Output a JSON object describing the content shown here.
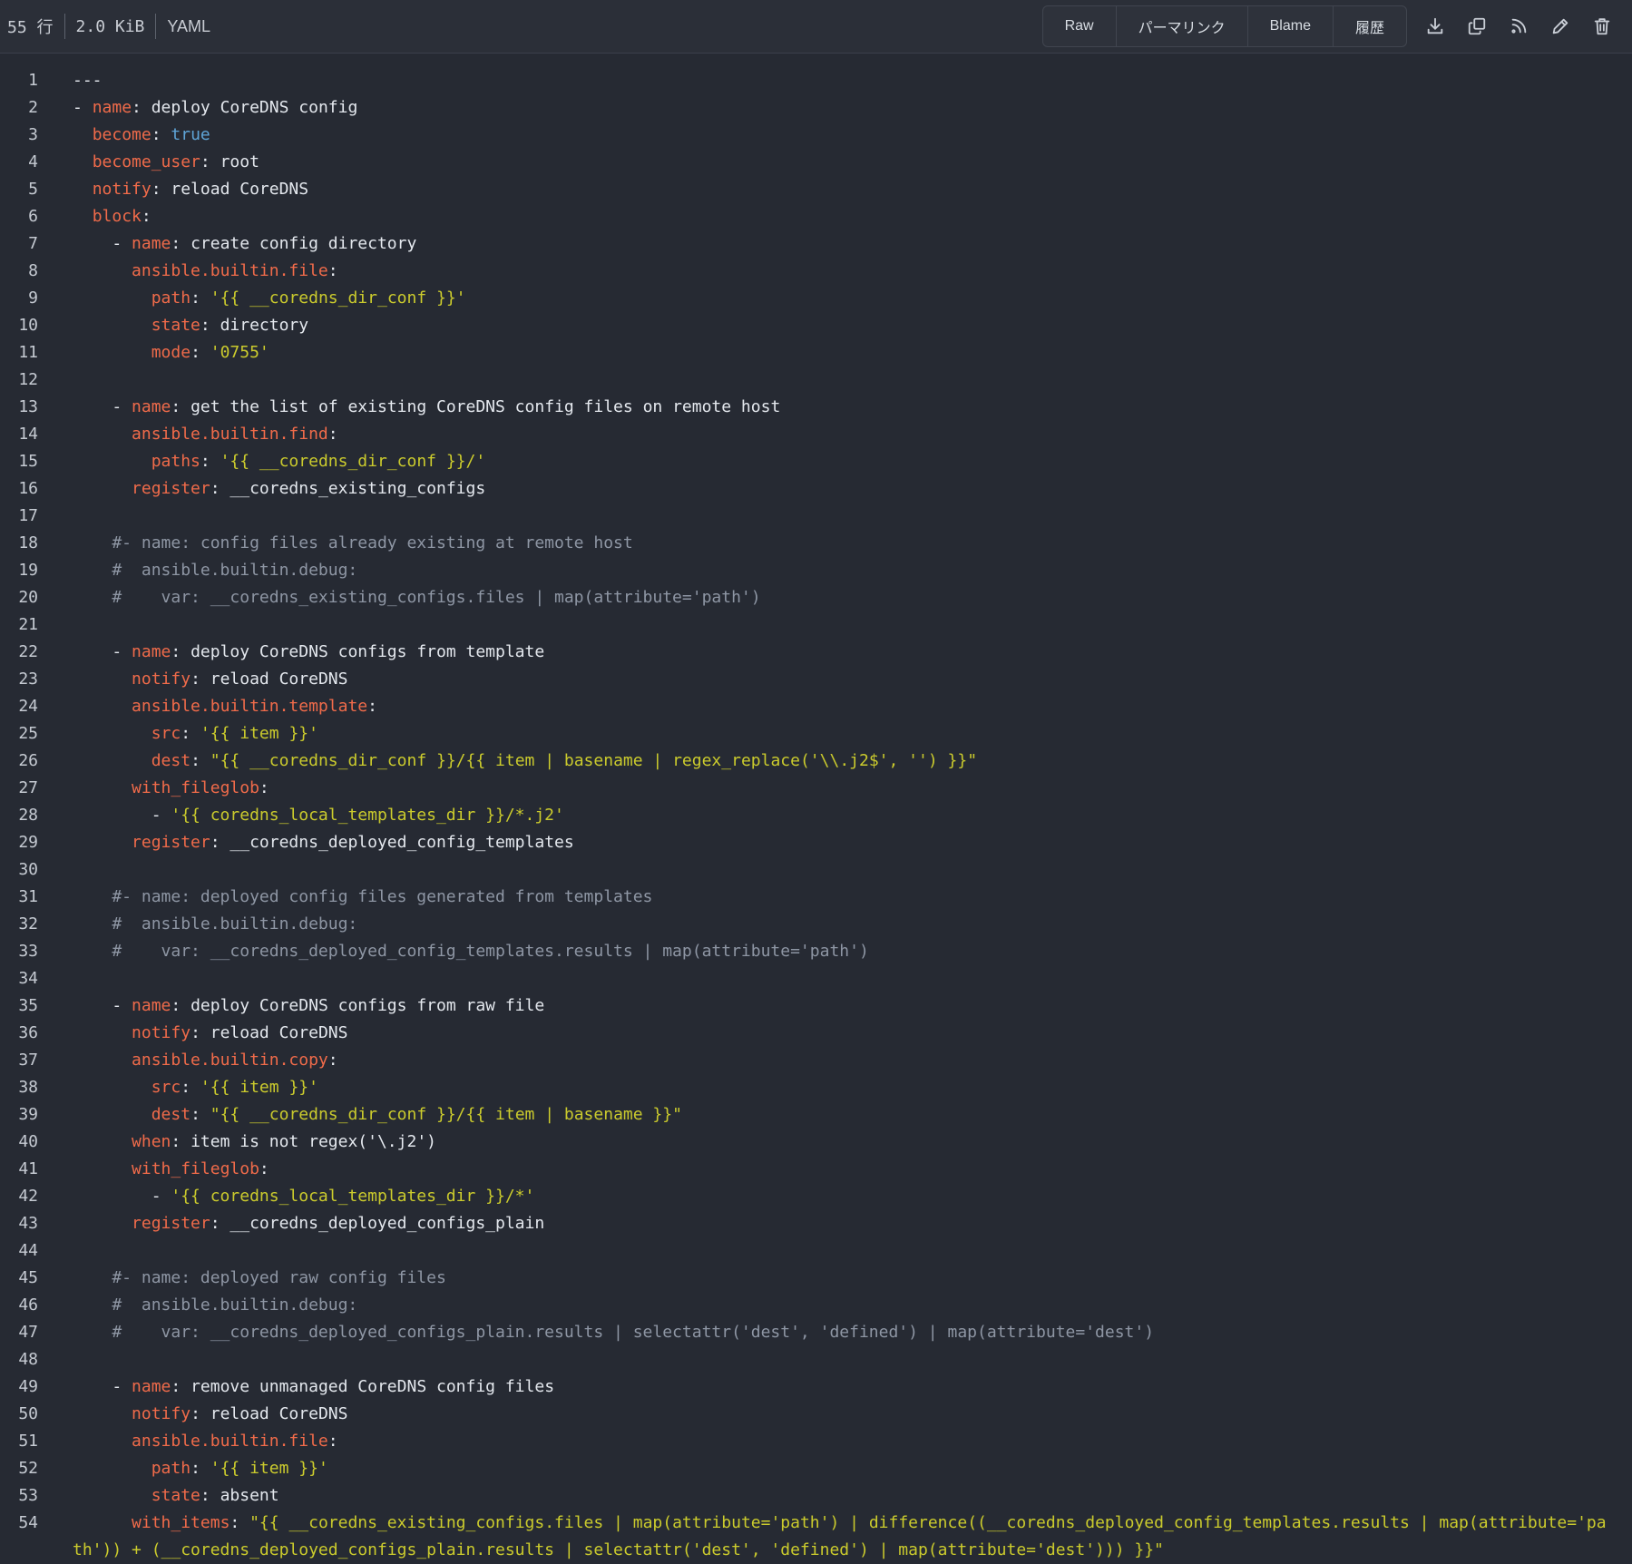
{
  "header": {
    "lines": "55 行",
    "size": "2.0 KiB",
    "language": "YAML",
    "buttons": [
      "Raw",
      "パーマリンク",
      "Blame",
      "履歴"
    ],
    "icons": [
      "download-icon",
      "copy-icon",
      "rss-icon",
      "edit-icon",
      "delete-icon"
    ]
  },
  "code": [
    {
      "n": "1",
      "p": [
        [
          "t",
          "---"
        ]
      ]
    },
    {
      "n": "2",
      "p": [
        [
          "t",
          "- "
        ],
        [
          "k",
          "name"
        ],
        [
          "t",
          ": deploy CoreDNS config"
        ]
      ]
    },
    {
      "n": "3",
      "p": [
        [
          "t",
          "  "
        ],
        [
          "k",
          "become"
        ],
        [
          "t",
          ": "
        ],
        [
          "b",
          "true"
        ]
      ]
    },
    {
      "n": "4",
      "p": [
        [
          "t",
          "  "
        ],
        [
          "k",
          "become_user"
        ],
        [
          "t",
          ": root"
        ]
      ]
    },
    {
      "n": "5",
      "p": [
        [
          "t",
          "  "
        ],
        [
          "k",
          "notify"
        ],
        [
          "t",
          ": reload CoreDNS"
        ]
      ]
    },
    {
      "n": "6",
      "p": [
        [
          "t",
          "  "
        ],
        [
          "k",
          "block"
        ],
        [
          "t",
          ":"
        ]
      ]
    },
    {
      "n": "7",
      "p": [
        [
          "t",
          "    - "
        ],
        [
          "k",
          "name"
        ],
        [
          "t",
          ": create config directory"
        ]
      ]
    },
    {
      "n": "8",
      "p": [
        [
          "t",
          "      "
        ],
        [
          "k",
          "ansible.builtin.file"
        ],
        [
          "t",
          ":"
        ]
      ]
    },
    {
      "n": "9",
      "p": [
        [
          "t",
          "        "
        ],
        [
          "k",
          "path"
        ],
        [
          "t",
          ": "
        ],
        [
          "s",
          "'{{ __coredns_dir_conf }}'"
        ]
      ]
    },
    {
      "n": "10",
      "p": [
        [
          "t",
          "        "
        ],
        [
          "k",
          "state"
        ],
        [
          "t",
          ": directory"
        ]
      ]
    },
    {
      "n": "11",
      "p": [
        [
          "t",
          "        "
        ],
        [
          "k",
          "mode"
        ],
        [
          "t",
          ": "
        ],
        [
          "s",
          "'0755'"
        ]
      ]
    },
    {
      "n": "12",
      "p": [
        [
          "t",
          ""
        ]
      ]
    },
    {
      "n": "13",
      "p": [
        [
          "t",
          "    - "
        ],
        [
          "k",
          "name"
        ],
        [
          "t",
          ": get the list of existing CoreDNS config files on remote host"
        ]
      ]
    },
    {
      "n": "14",
      "p": [
        [
          "t",
          "      "
        ],
        [
          "k",
          "ansible.builtin.find"
        ],
        [
          "t",
          ":"
        ]
      ]
    },
    {
      "n": "15",
      "p": [
        [
          "t",
          "        "
        ],
        [
          "k",
          "paths"
        ],
        [
          "t",
          ": "
        ],
        [
          "s",
          "'{{ __coredns_dir_conf }}/'"
        ]
      ]
    },
    {
      "n": "16",
      "p": [
        [
          "t",
          "      "
        ],
        [
          "k",
          "register"
        ],
        [
          "t",
          ": __coredns_existing_configs"
        ]
      ]
    },
    {
      "n": "17",
      "p": [
        [
          "t",
          ""
        ]
      ]
    },
    {
      "n": "18",
      "p": [
        [
          "c",
          "    #- name: config files already existing at remote host"
        ]
      ]
    },
    {
      "n": "19",
      "p": [
        [
          "c",
          "    #  ansible.builtin.debug:"
        ]
      ]
    },
    {
      "n": "20",
      "p": [
        [
          "c",
          "    #    var: __coredns_existing_configs.files | map(attribute='path')"
        ]
      ]
    },
    {
      "n": "21",
      "p": [
        [
          "t",
          ""
        ]
      ]
    },
    {
      "n": "22",
      "p": [
        [
          "t",
          "    - "
        ],
        [
          "k",
          "name"
        ],
        [
          "t",
          ": deploy CoreDNS configs from template"
        ]
      ]
    },
    {
      "n": "23",
      "p": [
        [
          "t",
          "      "
        ],
        [
          "k",
          "notify"
        ],
        [
          "t",
          ": reload CoreDNS"
        ]
      ]
    },
    {
      "n": "24",
      "p": [
        [
          "t",
          "      "
        ],
        [
          "k",
          "ansible.builtin.template"
        ],
        [
          "t",
          ":"
        ]
      ]
    },
    {
      "n": "25",
      "p": [
        [
          "t",
          "        "
        ],
        [
          "k",
          "src"
        ],
        [
          "t",
          ": "
        ],
        [
          "s",
          "'{{ item }}'"
        ]
      ]
    },
    {
      "n": "26",
      "p": [
        [
          "t",
          "        "
        ],
        [
          "k",
          "dest"
        ],
        [
          "t",
          ": "
        ],
        [
          "s",
          "\"{{ __coredns_dir_conf }}/{{ item | basename | regex_replace('\\\\.j2$', '') }}\""
        ]
      ]
    },
    {
      "n": "27",
      "p": [
        [
          "t",
          "      "
        ],
        [
          "k",
          "with_fileglob"
        ],
        [
          "t",
          ":"
        ]
      ]
    },
    {
      "n": "28",
      "p": [
        [
          "t",
          "        - "
        ],
        [
          "s",
          "'{{ coredns_local_templates_dir }}/*.j2'"
        ]
      ]
    },
    {
      "n": "29",
      "p": [
        [
          "t",
          "      "
        ],
        [
          "k",
          "register"
        ],
        [
          "t",
          ": __coredns_deployed_config_templates"
        ]
      ]
    },
    {
      "n": "30",
      "p": [
        [
          "t",
          ""
        ]
      ]
    },
    {
      "n": "31",
      "p": [
        [
          "c",
          "    #- name: deployed config files generated from templates"
        ]
      ]
    },
    {
      "n": "32",
      "p": [
        [
          "c",
          "    #  ansible.builtin.debug:"
        ]
      ]
    },
    {
      "n": "33",
      "p": [
        [
          "c",
          "    #    var: __coredns_deployed_config_templates.results | map(attribute='path')"
        ]
      ]
    },
    {
      "n": "34",
      "p": [
        [
          "t",
          ""
        ]
      ]
    },
    {
      "n": "35",
      "p": [
        [
          "t",
          "    - "
        ],
        [
          "k",
          "name"
        ],
        [
          "t",
          ": deploy CoreDNS configs from raw file"
        ]
      ]
    },
    {
      "n": "36",
      "p": [
        [
          "t",
          "      "
        ],
        [
          "k",
          "notify"
        ],
        [
          "t",
          ": reload CoreDNS"
        ]
      ]
    },
    {
      "n": "37",
      "p": [
        [
          "t",
          "      "
        ],
        [
          "k",
          "ansible.builtin.copy"
        ],
        [
          "t",
          ":"
        ]
      ]
    },
    {
      "n": "38",
      "p": [
        [
          "t",
          "        "
        ],
        [
          "k",
          "src"
        ],
        [
          "t",
          ": "
        ],
        [
          "s",
          "'{{ item }}'"
        ]
      ]
    },
    {
      "n": "39",
      "p": [
        [
          "t",
          "        "
        ],
        [
          "k",
          "dest"
        ],
        [
          "t",
          ": "
        ],
        [
          "s",
          "\"{{ __coredns_dir_conf }}/{{ item | basename }}\""
        ]
      ]
    },
    {
      "n": "40",
      "p": [
        [
          "t",
          "      "
        ],
        [
          "k",
          "when"
        ],
        [
          "t",
          ": item is not regex('\\.j2')"
        ]
      ]
    },
    {
      "n": "41",
      "p": [
        [
          "t",
          "      "
        ],
        [
          "k",
          "with_fileglob"
        ],
        [
          "t",
          ":"
        ]
      ]
    },
    {
      "n": "42",
      "p": [
        [
          "t",
          "        - "
        ],
        [
          "s",
          "'{{ coredns_local_templates_dir }}/*'"
        ]
      ]
    },
    {
      "n": "43",
      "p": [
        [
          "t",
          "      "
        ],
        [
          "k",
          "register"
        ],
        [
          "t",
          ": __coredns_deployed_configs_plain"
        ]
      ]
    },
    {
      "n": "44",
      "p": [
        [
          "t",
          ""
        ]
      ]
    },
    {
      "n": "45",
      "p": [
        [
          "c",
          "    #- name: deployed raw config files"
        ]
      ]
    },
    {
      "n": "46",
      "p": [
        [
          "c",
          "    #  ansible.builtin.debug:"
        ]
      ]
    },
    {
      "n": "47",
      "p": [
        [
          "c",
          "    #    var: __coredns_deployed_configs_plain.results | selectattr('dest', 'defined') | map(attribute='dest')"
        ]
      ]
    },
    {
      "n": "48",
      "p": [
        [
          "t",
          ""
        ]
      ]
    },
    {
      "n": "49",
      "p": [
        [
          "t",
          "    - "
        ],
        [
          "k",
          "name"
        ],
        [
          "t",
          ": remove unmanaged CoreDNS config files"
        ]
      ]
    },
    {
      "n": "50",
      "p": [
        [
          "t",
          "      "
        ],
        [
          "k",
          "notify"
        ],
        [
          "t",
          ": reload CoreDNS"
        ]
      ]
    },
    {
      "n": "51",
      "p": [
        [
          "t",
          "      "
        ],
        [
          "k",
          "ansible.builtin.file"
        ],
        [
          "t",
          ":"
        ]
      ]
    },
    {
      "n": "52",
      "p": [
        [
          "t",
          "        "
        ],
        [
          "k",
          "path"
        ],
        [
          "t",
          ": "
        ],
        [
          "s",
          "'{{ item }}'"
        ]
      ]
    },
    {
      "n": "53",
      "p": [
        [
          "t",
          "        "
        ],
        [
          "k",
          "state"
        ],
        [
          "t",
          ": absent"
        ]
      ]
    },
    {
      "n": "54",
      "wrap": true,
      "p": [
        [
          "t",
          "      "
        ],
        [
          "k",
          "with_items"
        ],
        [
          "t",
          ": "
        ],
        [
          "s",
          "\"{{ __coredns_existing_configs.files | map(attribute='path') | difference((__coredns_deployed_config_templates.results | map(attribute='path')) + (__coredns_deployed_configs_plain.results | selectattr('dest', 'defined') | map(attribute='dest'))) }}\""
        ]
      ]
    }
  ]
}
